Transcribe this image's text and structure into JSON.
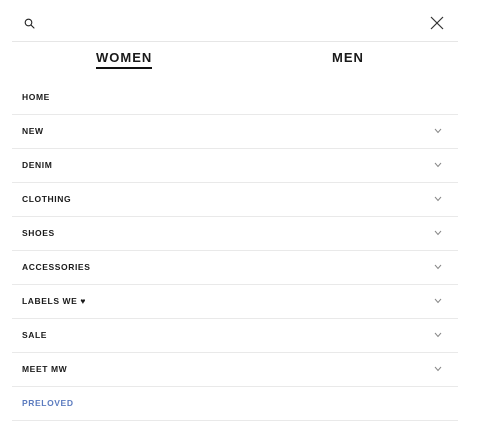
{
  "search": {
    "icon": "search-icon",
    "close_icon": "close-icon"
  },
  "tabs": [
    {
      "label": "WOMEN",
      "active": true
    },
    {
      "label": "MEN",
      "active": false
    }
  ],
  "menu": [
    {
      "label": "HOME",
      "has_chevron": false
    },
    {
      "label": "NEW",
      "has_chevron": true
    },
    {
      "label": "DENIM",
      "has_chevron": true
    },
    {
      "label": "CLOTHING",
      "has_chevron": true
    },
    {
      "label": "SHOES",
      "has_chevron": true
    },
    {
      "label": "ACCESSORIES",
      "has_chevron": true
    },
    {
      "label": "LABELS WE ♥",
      "has_chevron": true
    },
    {
      "label": "SALE",
      "has_chevron": true
    },
    {
      "label": "MEET MW",
      "has_chevron": true
    },
    {
      "label": "PRELOVED",
      "has_chevron": false,
      "color": "#5b7bbf"
    }
  ]
}
